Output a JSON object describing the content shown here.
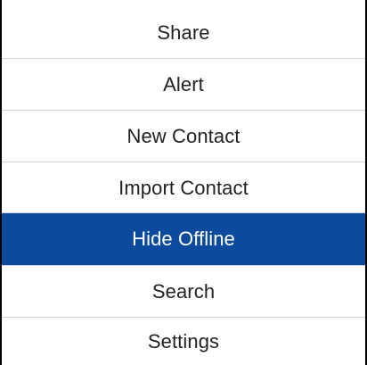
{
  "menu": {
    "items": [
      {
        "label": "Share"
      },
      {
        "label": "Alert"
      },
      {
        "label": "New Contact"
      },
      {
        "label": "Import Contact"
      },
      {
        "label": "Hide Offline"
      },
      {
        "label": "Search"
      },
      {
        "label": "Settings"
      }
    ],
    "selected_index": 4
  },
  "colors": {
    "selected_background": "#0b4a9d",
    "selected_text": "#ffffff",
    "item_text": "#222222",
    "divider": "#d6d6d6",
    "border": "#000000"
  }
}
